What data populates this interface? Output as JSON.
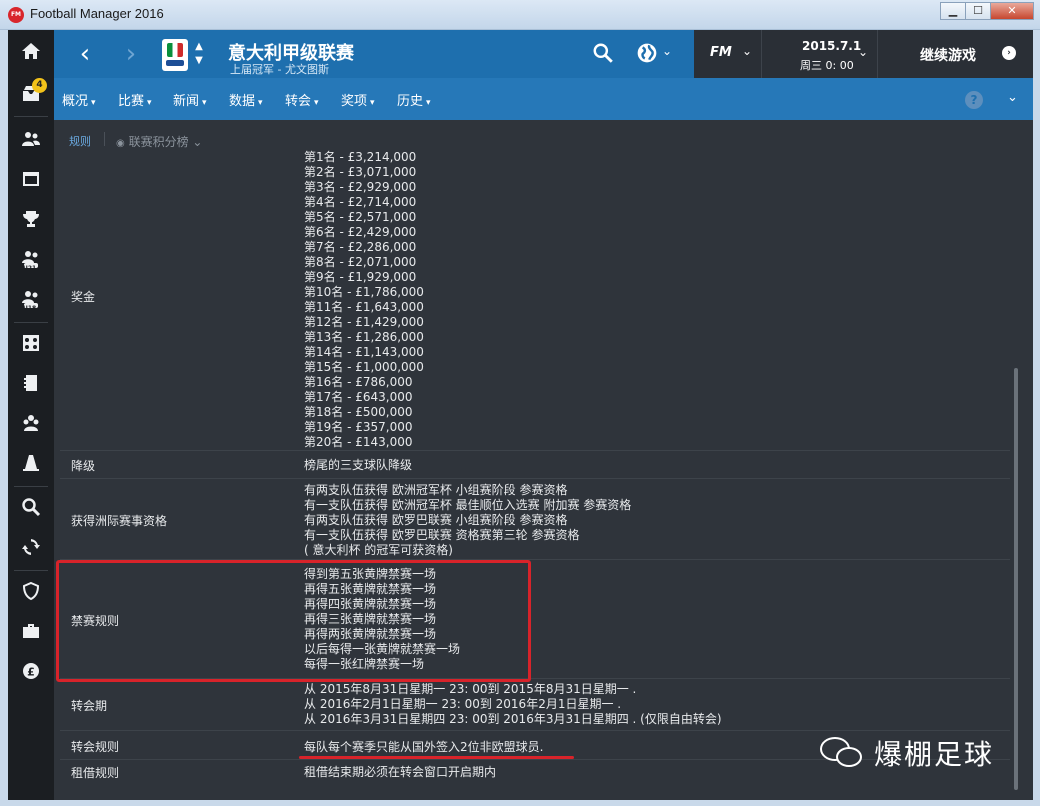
{
  "window": {
    "title": "Football Manager 2016",
    "app_icon": "FM",
    "btn_min": "▁",
    "btn_max": "☐",
    "btn_close": "✕"
  },
  "rail": {
    "inbox_badge": "4",
    "u21_label": "U21",
    "u18_label": "U18"
  },
  "header": {
    "back": "‹",
    "forward": "›",
    "title": "意大利甲级联赛",
    "subtitle": "上届冠军 - 尤文图斯",
    "fm_label": "FM",
    "date": "2015.7.1",
    "day_time": "周三 0: 00",
    "continue_label": "继续游戏",
    "menu": [
      "概况",
      "比赛",
      "新闻",
      "数据",
      "转会",
      "奖项",
      "历史"
    ]
  },
  "subtabs": {
    "active": "规则",
    "second": "联赛积分榜"
  },
  "rules": {
    "prize_label": "奖金",
    "prize_values": [
      "第1名 - £3,214,000",
      "第2名 - £3,071,000",
      "第3名 - £2,929,000",
      "第4名 - £2,714,000",
      "第5名 - £2,571,000",
      "第6名 - £2,429,000",
      "第7名 - £2,286,000",
      "第8名 - £2,071,000",
      "第9名 - £1,929,000",
      "第10名 - £1,786,000",
      "第11名 - £1,643,000",
      "第12名 - £1,429,000",
      "第13名 - £1,286,000",
      "第14名 - £1,143,000",
      "第15名 - £1,000,000",
      "第16名 - £786,000",
      "第17名 - £643,000",
      "第18名 - £500,000",
      "第19名 - £357,000",
      "第20名 - £143,000"
    ],
    "relegation_label": "降级",
    "relegation_value": "榜尾的三支球队降级",
    "continental_label": "获得洲际赛事资格",
    "continental_values": [
      "有两支队伍获得 欧洲冠军杯 小组赛阶段 参赛资格",
      "有一支队伍获得 欧洲冠军杯 最佳顺位入选赛 附加赛 参赛资格",
      "有两支队伍获得 欧罗巴联赛 小组赛阶段 参赛资格",
      "有一支队伍获得 欧罗巴联赛 资格赛第三轮 参赛资格",
      "( 意大利杯 的冠军可获资格)"
    ],
    "suspension_label": "禁赛规则",
    "suspension_values": [
      "得到第五张黄牌禁赛一场",
      "再得五张黄牌就禁赛一场",
      "再得四张黄牌就禁赛一场",
      "再得三张黄牌就禁赛一场",
      "再得两张黄牌就禁赛一场",
      "以后每得一张黄牌就禁赛一场",
      "每得一张红牌禁赛一场"
    ],
    "window_label": "转会期",
    "window_values": [
      "从 2015年8月31日星期一 23: 00到 2015年8月31日星期一 .",
      "从 2016年2月1日星期一 23: 00到 2016年2月1日星期一 .",
      "从 2016年3月31日星期四 23: 00到 2016年3月31日星期四 . (仅限自由转会)"
    ],
    "transfer_rule_label": "转会规则",
    "transfer_rule_value": "每队每个赛季只能从国外签入2位非欧盟球员.",
    "loan_label": "租借规则",
    "loan_value": "租借结束期必须在转会窗口开启期内"
  },
  "watermark": "爆棚足球",
  "colors": {
    "header_blue": "#1e6fae",
    "menu_blue": "#2678b8",
    "panel": "#2f343b",
    "rail": "#1b1e22",
    "highlight_red": "#d8232a",
    "badge_yellow": "#f2c21a"
  }
}
